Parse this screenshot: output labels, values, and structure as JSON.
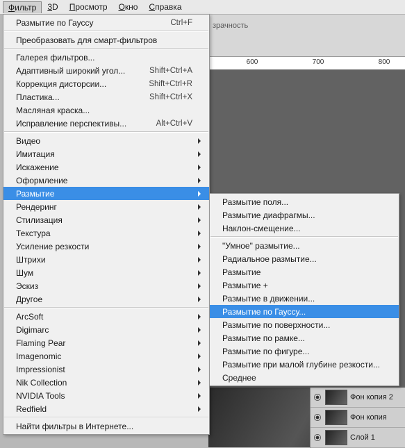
{
  "menubar": {
    "items": [
      {
        "label": "Фильтр",
        "mnemonic": 0,
        "open": true
      },
      {
        "label": "3D",
        "mnemonic": 0
      },
      {
        "label": "Просмотр",
        "mnemonic": 0
      },
      {
        "label": "Окно",
        "mnemonic": 0
      },
      {
        "label": "Справка",
        "mnemonic": 0
      }
    ]
  },
  "toolbar": {
    "opacity_label": "зрачность"
  },
  "ruler": {
    "ticks": [
      "600",
      "700",
      "800"
    ]
  },
  "dropdown": {
    "groups": [
      [
        {
          "label": "Размытие по Гауссу",
          "shortcut": "Ctrl+F"
        }
      ],
      [
        {
          "label": "Преобразовать для смарт-фильтров"
        }
      ],
      [
        {
          "label": "Галерея фильтров..."
        },
        {
          "label": "Адаптивный широкий угол...",
          "shortcut": "Shift+Ctrl+A"
        },
        {
          "label": "Коррекция дисторсии...",
          "shortcut": "Shift+Ctrl+R"
        },
        {
          "label": "Пластика...",
          "shortcut": "Shift+Ctrl+X"
        },
        {
          "label": "Масляная краска..."
        },
        {
          "label": "Исправление перспективы...",
          "shortcut": "Alt+Ctrl+V"
        }
      ],
      [
        {
          "label": "Видео",
          "sub": true
        },
        {
          "label": "Имитация",
          "sub": true
        },
        {
          "label": "Искажение",
          "sub": true
        },
        {
          "label": "Оформление",
          "sub": true
        },
        {
          "label": "Размытие",
          "sub": true,
          "highlight": true
        },
        {
          "label": "Рендеринг",
          "sub": true
        },
        {
          "label": "Стилизация",
          "sub": true
        },
        {
          "label": "Текстура",
          "sub": true
        },
        {
          "label": "Усиление резкости",
          "sub": true
        },
        {
          "label": "Штрихи",
          "sub": true
        },
        {
          "label": "Шум",
          "sub": true
        },
        {
          "label": "Эскиз",
          "sub": true
        },
        {
          "label": "Другое",
          "sub": true
        }
      ],
      [
        {
          "label": "ArcSoft",
          "sub": true
        },
        {
          "label": "Digimarc",
          "sub": true
        },
        {
          "label": "Flaming Pear",
          "sub": true
        },
        {
          "label": "Imagenomic",
          "sub": true
        },
        {
          "label": "Impressionist",
          "sub": true
        },
        {
          "label": "Nik Collection",
          "sub": true
        },
        {
          "label": "NVIDIA Tools",
          "sub": true
        },
        {
          "label": "Redfield",
          "sub": true
        }
      ],
      [
        {
          "label": "Найти фильтры в Интернете..."
        }
      ]
    ]
  },
  "submenu": {
    "groups": [
      [
        {
          "label": "Размытие поля..."
        },
        {
          "label": "Размытие диафрагмы..."
        },
        {
          "label": "Наклон-смещение..."
        }
      ],
      [
        {
          "label": "\"Умное\" размытие..."
        },
        {
          "label": "Радиальное размытие..."
        },
        {
          "label": "Размытие"
        },
        {
          "label": "Размытие +"
        },
        {
          "label": "Размытие в движении..."
        },
        {
          "label": "Размытие по Гауссу...",
          "highlight": true
        },
        {
          "label": "Размытие по поверхности..."
        },
        {
          "label": "Размытие по рамке..."
        },
        {
          "label": "Размытие по фигуре..."
        },
        {
          "label": "Размытие при малой глубине резкости..."
        },
        {
          "label": "Среднее"
        }
      ]
    ]
  },
  "layers": {
    "rows": [
      {
        "name": "Фон копия 2"
      },
      {
        "name": "Фон копия"
      },
      {
        "name": "Слой 1"
      }
    ]
  }
}
